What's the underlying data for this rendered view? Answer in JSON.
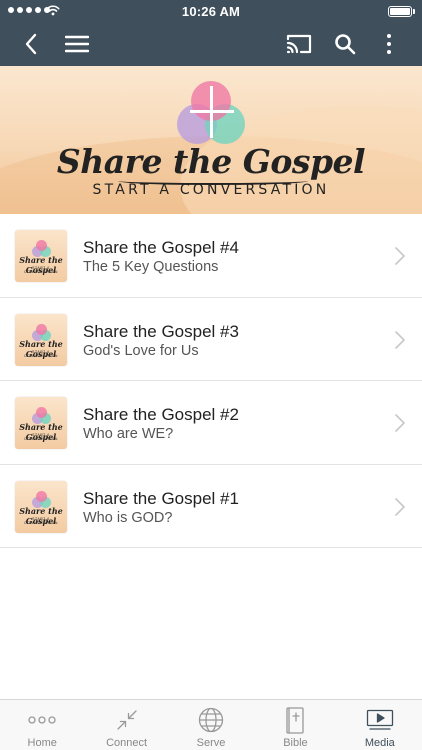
{
  "status_bar": {
    "time": "10:26 AM"
  },
  "banner": {
    "title": "Share the Gospel",
    "subtitle": "START A CONVERSATION"
  },
  "episodes": [
    {
      "title": "Share the Gospel #4",
      "subtitle": "The 5 Key Questions",
      "thumb_title": "Share the Gospel",
      "thumb_sub": "START A CONVERSATION"
    },
    {
      "title": "Share the Gospel #3",
      "subtitle": "God's Love for Us",
      "thumb_title": "Share the Gospel",
      "thumb_sub": "START A CONVERSATION"
    },
    {
      "title": "Share the Gospel #2",
      "subtitle": "Who are WE?",
      "thumb_title": "Share the Gospel",
      "thumb_sub": "START A CONVERSATION"
    },
    {
      "title": "Share the Gospel #1",
      "subtitle": "Who is GOD?",
      "thumb_title": "Share the Gospel",
      "thumb_sub": "START A CONVERSATION"
    }
  ],
  "tabs": [
    {
      "label": "Home",
      "icon": "dots-icon",
      "active": false
    },
    {
      "label": "Connect",
      "icon": "arrows-in-icon",
      "active": false
    },
    {
      "label": "Serve",
      "icon": "globe-icon",
      "active": false
    },
    {
      "label": "Bible",
      "icon": "bible-icon",
      "active": false
    },
    {
      "label": "Media",
      "icon": "play-screen-icon",
      "active": true
    }
  ],
  "colors": {
    "header": "#3f4f5c",
    "active_tab": "#3f4f5c",
    "inactive_tab": "#888888",
    "divider": "#e3e3e3"
  }
}
